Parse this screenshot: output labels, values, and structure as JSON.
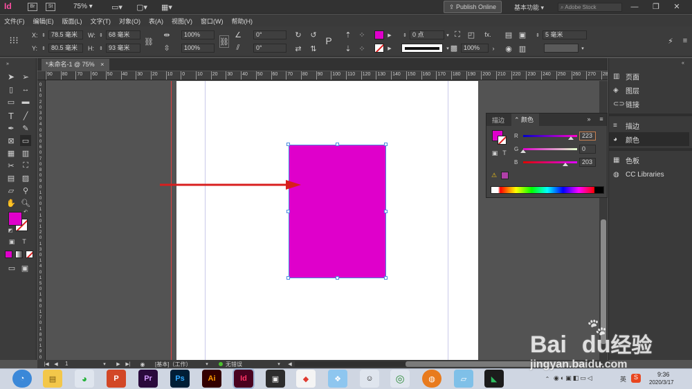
{
  "app": {
    "logo": "Id",
    "bridge": "Br",
    "stock": "St",
    "zoom": "75%",
    "publish": "Publish Online",
    "workspace": "基本功能",
    "search_placeholder": "Adobe Stock"
  },
  "menu": [
    "文件(F)",
    "编辑(E)",
    "版面(L)",
    "文字(T)",
    "对象(O)",
    "表(A)",
    "视图(V)",
    "窗口(W)",
    "帮助(H)"
  ],
  "control": {
    "x": "78.5 毫米",
    "y": "80.5 毫米",
    "w": "68 毫米",
    "h": "93 毫米",
    "scale_x": "100%",
    "scale_y": "100%",
    "angle": "0°",
    "shear": "0°",
    "stroke_weight": "0 点",
    "opacity": "100%",
    "gap": "5 毫米"
  },
  "tab": {
    "title": "*未命名-1 @ 75%",
    "close": "×"
  },
  "ruler": {
    "h_ticks": [
      "90",
      "80",
      "70",
      "60",
      "50",
      "40",
      "30",
      "20",
      "10",
      "0",
      "10",
      "20",
      "30",
      "40",
      "50",
      "60",
      "70",
      "80",
      "90",
      "100",
      "110",
      "120",
      "130",
      "140",
      "150",
      "160",
      "170",
      "180",
      "190",
      "200",
      "210",
      "220",
      "230",
      "240",
      "250",
      "260",
      "270",
      "280",
      "29"
    ],
    "v_ticks": [
      "0",
      "1",
      "0",
      "2",
      "0",
      "3",
      "0",
      "4",
      "0",
      "5",
      "0",
      "6",
      "0",
      "7",
      "0",
      "8",
      "0",
      "9",
      "0",
      "1",
      "0",
      "0",
      "1",
      "1",
      "0",
      "1",
      "2",
      "0",
      "1",
      "3",
      "0",
      "1",
      "4",
      "0",
      "1",
      "5",
      "0",
      "1",
      "6",
      "0",
      "1",
      "7",
      "0",
      "1",
      "8",
      "0",
      "1",
      "9",
      "0"
    ]
  },
  "colors": {
    "fill": "#df00cb",
    "accent": "#df00cb",
    "arrow": "#d81e1e"
  },
  "color_panel": {
    "tab_stroke": "描边",
    "tab_color": "颜色",
    "r_label": "R",
    "g_label": "G",
    "b_label": "B",
    "r": "223",
    "g": "0",
    "b": "203"
  },
  "panels": [
    {
      "icon": "▥",
      "label": "页面"
    },
    {
      "icon": "◈",
      "label": "图层"
    },
    {
      "icon": "⊂⊃",
      "label": "链接"
    },
    {
      "icon": "≡",
      "label": "描边"
    },
    {
      "icon": "◕",
      "label": "颜色"
    },
    {
      "icon": "▦",
      "label": "色板"
    },
    {
      "icon": "◍",
      "label": "CC Libraries"
    }
  ],
  "status": {
    "page": "1",
    "style": "[基本]（工作）",
    "preflight": "无错误"
  },
  "taskbar": {
    "time": "9:36",
    "date": "2020/3/17",
    "ime": "英",
    "apps": [
      "Pr",
      "Ps",
      "Ai",
      "Id"
    ]
  },
  "watermark": {
    "site": "jingyan.baidu.com",
    "brand": "Bai",
    "brand2": "du",
    "brand3": "经验"
  }
}
